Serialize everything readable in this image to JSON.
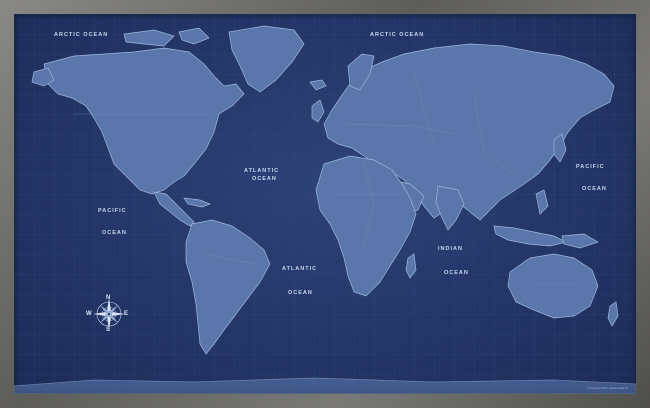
{
  "colors": {
    "frame": "#6b6a68",
    "ocean": "#243668",
    "land": "#5a76aa",
    "land_edge": "#9fb8de",
    "label": "#c9d6ef"
  },
  "oceans": {
    "arctic_left": "ARCTIC OCEAN",
    "arctic_right": "ARCTIC OCEAN",
    "atlantic_north_1": "ATLANTIC",
    "atlantic_north_2": "OCEAN",
    "atlantic_south_1": "ATLANTIC",
    "atlantic_south_2": "OCEAN",
    "pacific_left_1": "PACIFIC",
    "pacific_left_2": "OCEAN",
    "pacific_right_1": "PACIFIC",
    "pacific_right_2": "OCEAN",
    "indian_1": "INDIAN",
    "indian_2": "OCEAN"
  },
  "compass": {
    "north": "N",
    "south": "S",
    "east": "E",
    "west": "W"
  },
  "credit": "© Copyright 2016 · Modern Map Art"
}
